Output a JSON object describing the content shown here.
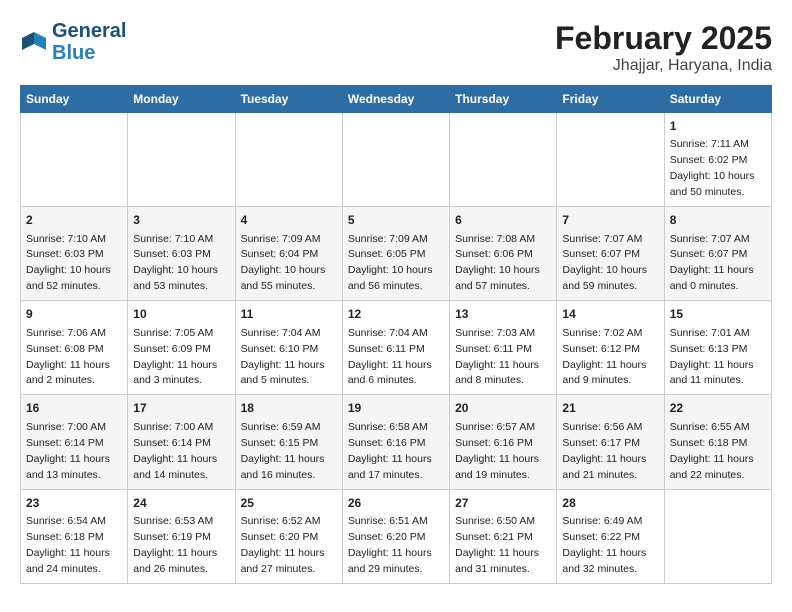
{
  "header": {
    "logo_line1": "General",
    "logo_line2": "Blue",
    "title": "February 2025",
    "subtitle": "Jhajjar, Haryana, India"
  },
  "days_of_week": [
    "Sunday",
    "Monday",
    "Tuesday",
    "Wednesday",
    "Thursday",
    "Friday",
    "Saturday"
  ],
  "weeks": [
    [
      {
        "day": "",
        "info": ""
      },
      {
        "day": "",
        "info": ""
      },
      {
        "day": "",
        "info": ""
      },
      {
        "day": "",
        "info": ""
      },
      {
        "day": "",
        "info": ""
      },
      {
        "day": "",
        "info": ""
      },
      {
        "day": "1",
        "info": "Sunrise: 7:11 AM\nSunset: 6:02 PM\nDaylight: 10 hours\nand 50 minutes."
      }
    ],
    [
      {
        "day": "2",
        "info": "Sunrise: 7:10 AM\nSunset: 6:03 PM\nDaylight: 10 hours\nand 52 minutes."
      },
      {
        "day": "3",
        "info": "Sunrise: 7:10 AM\nSunset: 6:03 PM\nDaylight: 10 hours\nand 53 minutes."
      },
      {
        "day": "4",
        "info": "Sunrise: 7:09 AM\nSunset: 6:04 PM\nDaylight: 10 hours\nand 55 minutes."
      },
      {
        "day": "5",
        "info": "Sunrise: 7:09 AM\nSunset: 6:05 PM\nDaylight: 10 hours\nand 56 minutes."
      },
      {
        "day": "6",
        "info": "Sunrise: 7:08 AM\nSunset: 6:06 PM\nDaylight: 10 hours\nand 57 minutes."
      },
      {
        "day": "7",
        "info": "Sunrise: 7:07 AM\nSunset: 6:07 PM\nDaylight: 10 hours\nand 59 minutes."
      },
      {
        "day": "8",
        "info": "Sunrise: 7:07 AM\nSunset: 6:07 PM\nDaylight: 11 hours\nand 0 minutes."
      }
    ],
    [
      {
        "day": "9",
        "info": "Sunrise: 7:06 AM\nSunset: 6:08 PM\nDaylight: 11 hours\nand 2 minutes."
      },
      {
        "day": "10",
        "info": "Sunrise: 7:05 AM\nSunset: 6:09 PM\nDaylight: 11 hours\nand 3 minutes."
      },
      {
        "day": "11",
        "info": "Sunrise: 7:04 AM\nSunset: 6:10 PM\nDaylight: 11 hours\nand 5 minutes."
      },
      {
        "day": "12",
        "info": "Sunrise: 7:04 AM\nSunset: 6:11 PM\nDaylight: 11 hours\nand 6 minutes."
      },
      {
        "day": "13",
        "info": "Sunrise: 7:03 AM\nSunset: 6:11 PM\nDaylight: 11 hours\nand 8 minutes."
      },
      {
        "day": "14",
        "info": "Sunrise: 7:02 AM\nSunset: 6:12 PM\nDaylight: 11 hours\nand 9 minutes."
      },
      {
        "day": "15",
        "info": "Sunrise: 7:01 AM\nSunset: 6:13 PM\nDaylight: 11 hours\nand 11 minutes."
      }
    ],
    [
      {
        "day": "16",
        "info": "Sunrise: 7:00 AM\nSunset: 6:14 PM\nDaylight: 11 hours\nand 13 minutes."
      },
      {
        "day": "17",
        "info": "Sunrise: 7:00 AM\nSunset: 6:14 PM\nDaylight: 11 hours\nand 14 minutes."
      },
      {
        "day": "18",
        "info": "Sunrise: 6:59 AM\nSunset: 6:15 PM\nDaylight: 11 hours\nand 16 minutes."
      },
      {
        "day": "19",
        "info": "Sunrise: 6:58 AM\nSunset: 6:16 PM\nDaylight: 11 hours\nand 17 minutes."
      },
      {
        "day": "20",
        "info": "Sunrise: 6:57 AM\nSunset: 6:16 PM\nDaylight: 11 hours\nand 19 minutes."
      },
      {
        "day": "21",
        "info": "Sunrise: 6:56 AM\nSunset: 6:17 PM\nDaylight: 11 hours\nand 21 minutes."
      },
      {
        "day": "22",
        "info": "Sunrise: 6:55 AM\nSunset: 6:18 PM\nDaylight: 11 hours\nand 22 minutes."
      }
    ],
    [
      {
        "day": "23",
        "info": "Sunrise: 6:54 AM\nSunset: 6:18 PM\nDaylight: 11 hours\nand 24 minutes."
      },
      {
        "day": "24",
        "info": "Sunrise: 6:53 AM\nSunset: 6:19 PM\nDaylight: 11 hours\nand 26 minutes."
      },
      {
        "day": "25",
        "info": "Sunrise: 6:52 AM\nSunset: 6:20 PM\nDaylight: 11 hours\nand 27 minutes."
      },
      {
        "day": "26",
        "info": "Sunrise: 6:51 AM\nSunset: 6:20 PM\nDaylight: 11 hours\nand 29 minutes."
      },
      {
        "day": "27",
        "info": "Sunrise: 6:50 AM\nSunset: 6:21 PM\nDaylight: 11 hours\nand 31 minutes."
      },
      {
        "day": "28",
        "info": "Sunrise: 6:49 AM\nSunset: 6:22 PM\nDaylight: 11 hours\nand 32 minutes."
      },
      {
        "day": "",
        "info": ""
      }
    ]
  ]
}
